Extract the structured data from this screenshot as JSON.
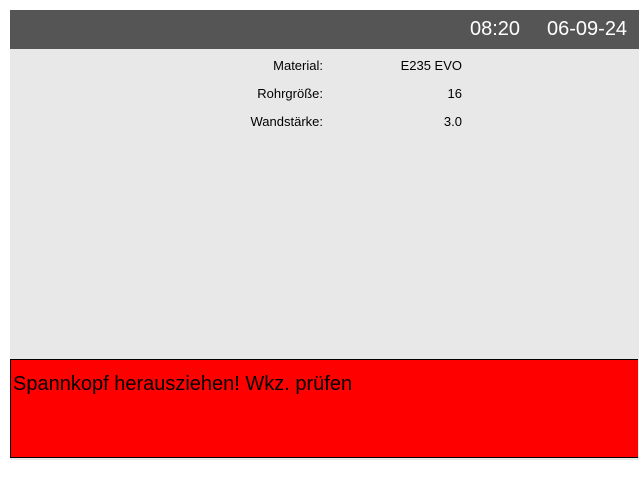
{
  "header": {
    "time": "08:20",
    "date": "06-09-24"
  },
  "parameters": [
    {
      "label": "Material:",
      "value": "E235 EVO"
    },
    {
      "label": "Rohrgröße:",
      "value": "16"
    },
    {
      "label": "Wandstärke:",
      "value": "3.0"
    }
  ],
  "alarm": {
    "message": "Spannkopf herausziehen! Wkz. prüfen",
    "background_color": "#ff0000"
  },
  "colors": {
    "header_bg": "#555555",
    "screen_bg": "#e8e8e8"
  }
}
